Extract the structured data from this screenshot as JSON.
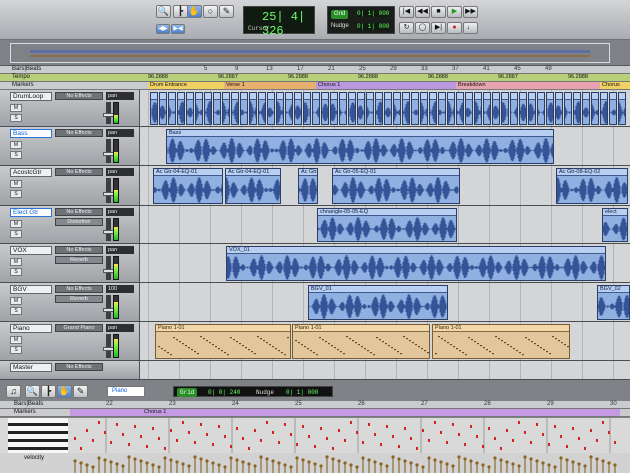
{
  "toolbar": {
    "counter_value": "25| 4| 326",
    "counter_label": "Cursor",
    "grid_label": "Grid",
    "grid_value": "0| 1| 000",
    "nudge_label": "Nudge",
    "nudge_value": "0| 1| 000"
  },
  "rulers": {
    "bars_label": "Bars|Beats",
    "tempo_label": "Tempo",
    "markers_label": "Markers",
    "tempo_values": [
      "96.2888",
      "96.2887",
      "96.2888",
      "96.2888",
      "96.2888",
      "96.2887",
      "96.2888"
    ],
    "bar_numbers": [
      "5",
      "9",
      "13",
      "17",
      "21",
      "25",
      "29",
      "33",
      "37",
      "41",
      "45",
      "49"
    ],
    "marker_names": [
      "Drum Entrance",
      "Verse 1",
      "Chorus 1",
      "Breakdown",
      "Chorus"
    ]
  },
  "tracks": [
    {
      "name": "DrumLoop",
      "effect": "No Effects",
      "pan": "pan"
    },
    {
      "name": "Bass",
      "effect": "No Effects",
      "pan": "pan"
    },
    {
      "name": "AcostcGtr",
      "effect": "No Effects",
      "pan": "pan"
    },
    {
      "name": "Elect Gtr",
      "effect": "No Effects",
      "effect2": "Distortion",
      "pan": "pan",
      "pan_value": "70"
    },
    {
      "name": "VOX",
      "effect": "No Effects",
      "effect2": "Reverb",
      "pan": "pan"
    },
    {
      "name": "BGV",
      "effect": "No Effects",
      "effect2": "Reverb",
      "pan": "100",
      "pan_value": "100"
    },
    {
      "name": "Piano",
      "effect": "Grand Piano",
      "pan": "pan"
    },
    {
      "name": "Master",
      "effect": "No Effects",
      "pan": ""
    }
  ],
  "clips": {
    "bass": "Bass",
    "ac1": "Ac Gtr-04-EQ-01",
    "ac2": "Ac Gtr-04-EQ-01",
    "ac3": "Ac Gtr",
    "ac4": "Ac Gtr-05-EQ-01",
    "ac5": "Ac Gtr-08-EQ-02",
    "el1": "chnangle-05-05-EQ",
    "el2": "elect",
    "vox": "VOX_01",
    "bgv1": "BGV_01",
    "bgv2": "BGV_02",
    "piano1": "Piano 1-01",
    "piano2": "Piano 1-01",
    "piano3": "Piano 1-01"
  },
  "bottom": {
    "track_name": "Piano",
    "grid_label": "Grid",
    "grid_value": "0| 0| 240",
    "nudge_label": "Nudge",
    "nudge_value": "0| 1| 000",
    "bars_label": "Bars|Beats",
    "markers_label": "Markers",
    "marker_name": "Chorus 1",
    "velocity_label": "velocity",
    "bar_numbers": [
      "22",
      "23",
      "24",
      "25",
      "26",
      "27",
      "28",
      "29",
      "30"
    ]
  },
  "colors": {
    "audio_clip": "#8fb0e0",
    "midi_clip": "#e2c79d",
    "waveform": "#1e3d85",
    "meter": "#23b829"
  }
}
